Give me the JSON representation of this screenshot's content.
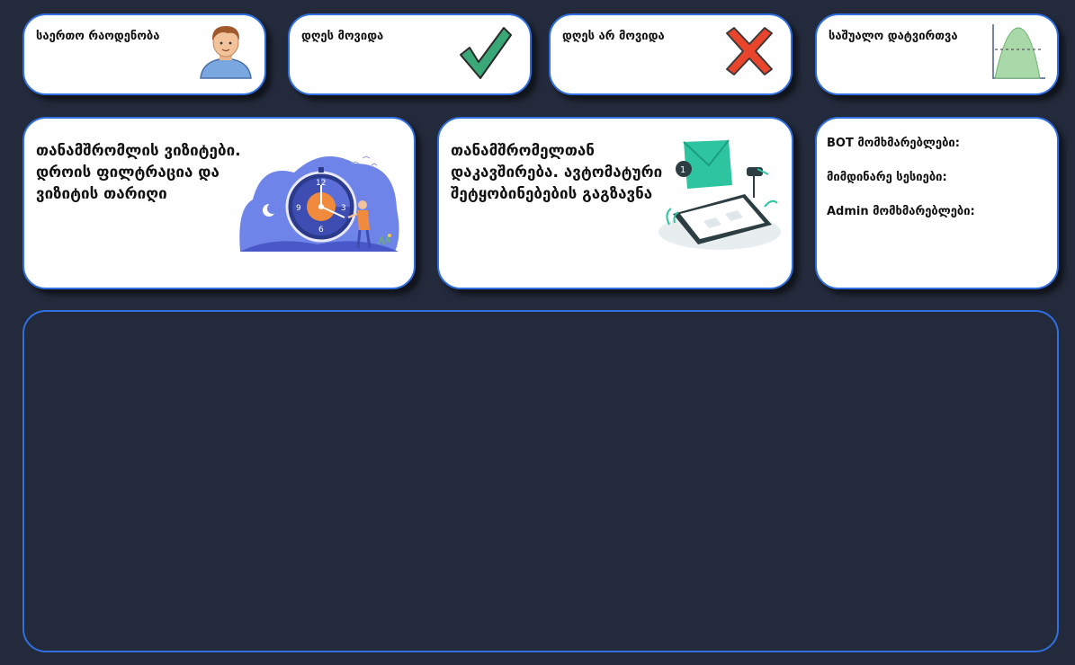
{
  "stats": {
    "total_count_label": "საერთო რაოდენობა",
    "came_today_label": "დღეს მოვიდა",
    "not_came_today_label": "დღეს არ მოვიდა",
    "average_load_label": "საშუალო დატვირთვა"
  },
  "visits_card": {
    "title_lines": [
      "თანამშრომლის ვიზიტები.",
      "დროის ფილტრაცია და",
      "ვიზიტის თარიღი"
    ]
  },
  "contact_card": {
    "title_lines": [
      "თანამშრომელთან",
      "დაკავშირება. ავტომატური",
      "შეტყობინებების გაგზავნა"
    ]
  },
  "bot_card": {
    "bot_users_label": "BOT მომხმარებლები:",
    "current_sessions_label": "მიმდინარე სესიები:",
    "admin_users_label": "Admin მომხმარებლები:"
  },
  "colors": {
    "background": "#232a3b",
    "card_border": "#2f6fe0",
    "check_green": "#3aa876",
    "cross_red": "#e8452c"
  },
  "icons": {
    "total": "person-icon",
    "came": "checkmark-icon",
    "not_came": "x-mark-icon",
    "load": "bell-curve-chart-icon"
  }
}
